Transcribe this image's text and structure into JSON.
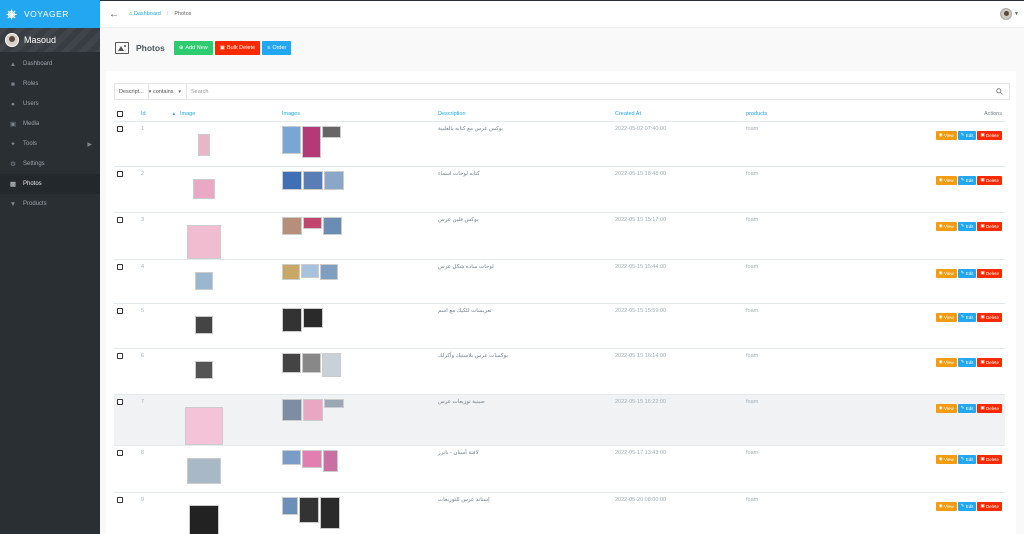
{
  "app": {
    "brand": "VOYAGER",
    "user_name": "Masoud"
  },
  "sidebar": {
    "items": [
      {
        "label": "Dashboard",
        "icon": "boat-icon"
      },
      {
        "label": "Roles",
        "icon": "lock-icon"
      },
      {
        "label": "Users",
        "icon": "person-icon"
      },
      {
        "label": "Media",
        "icon": "image-icon"
      },
      {
        "label": "Tools",
        "icon": "wrench-icon"
      },
      {
        "label": "Settings",
        "icon": "gear-icon"
      },
      {
        "label": "Photos",
        "icon": "camera-icon"
      },
      {
        "label": "Products",
        "icon": "basket-icon"
      }
    ]
  },
  "breadcrumb": {
    "home": "Dashboard",
    "current": "Photos"
  },
  "header": {
    "title": "Photos",
    "add_label": "Add New",
    "bulk_delete_label": "Bulk Delete",
    "order_label": "Order"
  },
  "search": {
    "field_value": "Descript...",
    "operator_value": "contains",
    "placeholder": "Search"
  },
  "table": {
    "columns": {
      "id": "Id",
      "image": "Image",
      "images": "Images",
      "description": "Description",
      "created_at": "Created At",
      "products": "products",
      "actions": "Actions"
    },
    "action_labels": {
      "view": "View",
      "edit": "Edit",
      "delete": "Delete"
    },
    "rows": [
      {
        "id": "1",
        "description": "بوكس عرس مع كتابه بالعلبية",
        "created_at": "2022-05-02 07:40:00",
        "products": "foam"
      },
      {
        "id": "2",
        "description": "كتابه لوحات اسماء",
        "created_at": "2022-05-15 18:48:00",
        "products": "foam"
      },
      {
        "id": "3",
        "description": "بوكس فلين عرس",
        "created_at": "2022-05-15 15:17:00",
        "products": "foam"
      },
      {
        "id": "4",
        "description": "لوحات ساده شكل عرس",
        "created_at": "2022-05-15 15:44:00",
        "products": "foam"
      },
      {
        "id": "5",
        "description": "تعريسات للكيك مع اسم",
        "created_at": "2022-05-15 15:59:00",
        "products": "foam"
      },
      {
        "id": "6",
        "description": "بوكسات عرس بلاستيك وأكرلك",
        "created_at": "2022-05-15 16:14:00",
        "products": "foam"
      },
      {
        "id": "7",
        "description": "صينية توزيعات عرس",
        "created_at": "2022-05-15 16:22:00",
        "products": "foam"
      },
      {
        "id": "8",
        "description": "لافتة أسنان - بانرز",
        "created_at": "2022-05-17 13:43:00",
        "products": "foam"
      },
      {
        "id": "9",
        "description": "إستاند عرس للتوزيعات",
        "created_at": "2022-05-20 08:00:00",
        "products": "foam"
      }
    ]
  }
}
